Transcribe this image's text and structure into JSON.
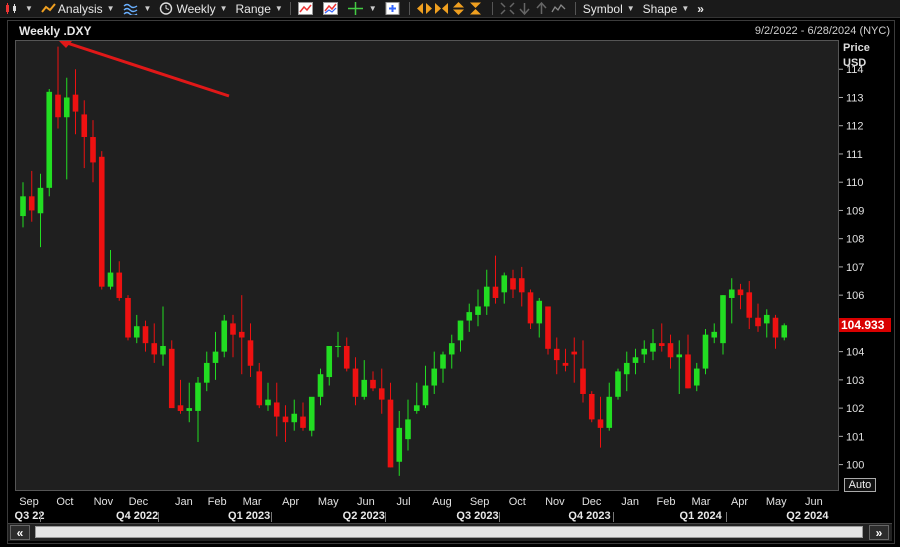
{
  "toolbar": {
    "analysis_label": "Analysis",
    "period_label": "Weekly",
    "range_label": "Range",
    "symbol_label": "Symbol",
    "shape_label": "Shape",
    "more_label": "»"
  },
  "header": {
    "title": "Weekly .DXY",
    "date_range": "9/2/2022 - 6/28/2024 (NYC)"
  },
  "axis": {
    "price_label": "Price",
    "unit_label": "USD",
    "auto_label": "Auto",
    "last_price_label": "104.933"
  },
  "colors": {
    "up": "#22dd22",
    "down": "#ee1111",
    "annotation": "#e01818",
    "price_tag": "#d90000"
  },
  "chart_data": {
    "type": "candlestick",
    "title": "Weekly .DXY",
    "ylabel": "Price USD",
    "ylim": [
      99.1,
      115
    ],
    "yticks": [
      100,
      101,
      102,
      103,
      104,
      105,
      106,
      107,
      108,
      109,
      110,
      111,
      112,
      113,
      114
    ],
    "last_price": 104.933,
    "month_labels": [
      "Sep",
      "Oct",
      "Nov",
      "Dec",
      "Jan",
      "Feb",
      "Mar",
      "Apr",
      "May",
      "Jun",
      "Jul",
      "Aug",
      "Sep",
      "Oct",
      "Nov",
      "Dec",
      "Jan",
      "Feb",
      "Mar",
      "Apr",
      "May",
      "Jun"
    ],
    "quarter_labels": [
      "Q3 22",
      "Q4 2022",
      "Q1 2023",
      "Q2 2023",
      "Q3 2023",
      "Q4 2023",
      "Q1 2024",
      "Q2 2024"
    ],
    "candles": [
      {
        "o": 108.8,
        "h": 110.0,
        "l": 108.4,
        "c": 109.5
      },
      {
        "o": 109.5,
        "h": 110.4,
        "l": 108.6,
        "c": 109.0
      },
      {
        "o": 108.9,
        "h": 110.3,
        "l": 107.7,
        "c": 109.8
      },
      {
        "o": 109.8,
        "h": 113.3,
        "l": 109.5,
        "c": 113.2
      },
      {
        "o": 113.1,
        "h": 114.8,
        "l": 111.9,
        "c": 112.3
      },
      {
        "o": 112.3,
        "h": 113.7,
        "l": 110.1,
        "c": 113.0
      },
      {
        "o": 113.1,
        "h": 114.0,
        "l": 111.7,
        "c": 112.5
      },
      {
        "o": 112.4,
        "h": 112.9,
        "l": 110.5,
        "c": 111.6
      },
      {
        "o": 111.6,
        "h": 112.2,
        "l": 110.0,
        "c": 110.7
      },
      {
        "o": 110.9,
        "h": 111.1,
        "l": 106.2,
        "c": 106.3
      },
      {
        "o": 106.3,
        "h": 107.6,
        "l": 106.2,
        "c": 106.8
      },
      {
        "o": 106.8,
        "h": 107.2,
        "l": 105.8,
        "c": 105.9
      },
      {
        "o": 105.9,
        "h": 106.0,
        "l": 104.4,
        "c": 104.5
      },
      {
        "o": 104.5,
        "h": 105.3,
        "l": 104.3,
        "c": 104.9
      },
      {
        "o": 104.9,
        "h": 105.1,
        "l": 104.0,
        "c": 104.3
      },
      {
        "o": 104.3,
        "h": 105.0,
        "l": 103.6,
        "c": 103.9
      },
      {
        "o": 103.9,
        "h": 105.6,
        "l": 103.5,
        "c": 104.2
      },
      {
        "o": 104.1,
        "h": 104.4,
        "l": 102.8,
        "c": 102.0
      },
      {
        "o": 102.1,
        "h": 103.0,
        "l": 101.8,
        "c": 101.9
      },
      {
        "o": 101.9,
        "h": 102.9,
        "l": 101.5,
        "c": 102.0
      },
      {
        "o": 101.9,
        "h": 103.1,
        "l": 100.8,
        "c": 102.9
      },
      {
        "o": 102.9,
        "h": 104.0,
        "l": 102.6,
        "c": 103.6
      },
      {
        "o": 103.6,
        "h": 104.7,
        "l": 103.0,
        "c": 104.0
      },
      {
        "o": 104.0,
        "h": 105.3,
        "l": 103.8,
        "c": 105.1
      },
      {
        "o": 105.0,
        "h": 105.3,
        "l": 103.8,
        "c": 104.6
      },
      {
        "o": 104.7,
        "h": 106.0,
        "l": 103.2,
        "c": 104.5
      },
      {
        "o": 104.4,
        "h": 105.0,
        "l": 103.1,
        "c": 103.5
      },
      {
        "o": 103.3,
        "h": 103.6,
        "l": 102.0,
        "c": 102.1
      },
      {
        "o": 102.1,
        "h": 102.9,
        "l": 101.9,
        "c": 102.3
      },
      {
        "o": 102.2,
        "h": 102.9,
        "l": 101.0,
        "c": 101.7
      },
      {
        "o": 101.7,
        "h": 102.1,
        "l": 100.8,
        "c": 101.5
      },
      {
        "o": 101.5,
        "h": 102.3,
        "l": 101.2,
        "c": 101.8
      },
      {
        "o": 101.7,
        "h": 102.2,
        "l": 101.2,
        "c": 101.3
      },
      {
        "o": 101.2,
        "h": 102.0,
        "l": 101.0,
        "c": 102.4
      },
      {
        "o": 102.4,
        "h": 103.4,
        "l": 102.1,
        "c": 103.2
      },
      {
        "o": 103.1,
        "h": 104.1,
        "l": 102.8,
        "c": 104.2
      },
      {
        "o": 104.2,
        "h": 104.7,
        "l": 103.8,
        "c": 104.2
      },
      {
        "o": 104.2,
        "h": 104.5,
        "l": 103.3,
        "c": 103.4
      },
      {
        "o": 103.4,
        "h": 103.8,
        "l": 102.1,
        "c": 102.4
      },
      {
        "o": 102.4,
        "h": 103.7,
        "l": 102.3,
        "c": 103.0
      },
      {
        "o": 103.0,
        "h": 103.3,
        "l": 102.6,
        "c": 102.7
      },
      {
        "o": 102.7,
        "h": 103.4,
        "l": 101.8,
        "c": 102.3
      },
      {
        "o": 102.3,
        "h": 102.9,
        "l": 99.9,
        "c": 99.9
      },
      {
        "o": 100.1,
        "h": 101.9,
        "l": 99.6,
        "c": 101.3
      },
      {
        "o": 100.9,
        "h": 102.3,
        "l": 100.5,
        "c": 101.6
      },
      {
        "o": 101.9,
        "h": 102.9,
        "l": 101.8,
        "c": 102.1
      },
      {
        "o": 102.1,
        "h": 103.5,
        "l": 102.0,
        "c": 102.8
      },
      {
        "o": 102.8,
        "h": 104.0,
        "l": 102.5,
        "c": 103.4
      },
      {
        "o": 103.4,
        "h": 104.0,
        "l": 102.9,
        "c": 103.9
      },
      {
        "o": 103.9,
        "h": 104.6,
        "l": 103.4,
        "c": 104.3
      },
      {
        "o": 104.4,
        "h": 105.1,
        "l": 104.0,
        "c": 105.1
      },
      {
        "o": 105.1,
        "h": 105.7,
        "l": 104.7,
        "c": 105.4
      },
      {
        "o": 105.3,
        "h": 106.2,
        "l": 104.9,
        "c": 105.6
      },
      {
        "o": 105.6,
        "h": 106.9,
        "l": 105.3,
        "c": 106.3
      },
      {
        "o": 106.3,
        "h": 107.4,
        "l": 105.7,
        "c": 105.9
      },
      {
        "o": 106.1,
        "h": 106.8,
        "l": 105.7,
        "c": 106.7
      },
      {
        "o": 106.6,
        "h": 106.9,
        "l": 105.9,
        "c": 106.2
      },
      {
        "o": 106.6,
        "h": 107.0,
        "l": 105.6,
        "c": 106.1
      },
      {
        "o": 106.1,
        "h": 106.2,
        "l": 104.8,
        "c": 105.0
      },
      {
        "o": 105.0,
        "h": 105.9,
        "l": 104.5,
        "c": 105.8
      },
      {
        "o": 105.6,
        "h": 105.6,
        "l": 103.9,
        "c": 104.1
      },
      {
        "o": 104.1,
        "h": 104.5,
        "l": 103.2,
        "c": 103.7
      },
      {
        "o": 103.6,
        "h": 104.1,
        "l": 103.3,
        "c": 103.5
      },
      {
        "o": 104.0,
        "h": 104.5,
        "l": 102.9,
        "c": 103.9
      },
      {
        "o": 103.4,
        "h": 104.4,
        "l": 102.2,
        "c": 102.5
      },
      {
        "o": 102.5,
        "h": 102.6,
        "l": 101.5,
        "c": 101.6
      },
      {
        "o": 101.6,
        "h": 102.4,
        "l": 100.6,
        "c": 101.3
      },
      {
        "o": 101.3,
        "h": 102.9,
        "l": 101.2,
        "c": 102.4
      },
      {
        "o": 102.4,
        "h": 103.4,
        "l": 102.3,
        "c": 103.3
      },
      {
        "o": 103.2,
        "h": 104.0,
        "l": 102.6,
        "c": 103.6
      },
      {
        "o": 103.6,
        "h": 104.1,
        "l": 103.2,
        "c": 103.8
      },
      {
        "o": 103.9,
        "h": 104.4,
        "l": 103.6,
        "c": 104.1
      },
      {
        "o": 104.0,
        "h": 104.8,
        "l": 103.7,
        "c": 104.3
      },
      {
        "o": 104.3,
        "h": 105.0,
        "l": 104.0,
        "c": 104.2
      },
      {
        "o": 104.3,
        "h": 104.6,
        "l": 103.4,
        "c": 103.8
      },
      {
        "o": 103.8,
        "h": 104.4,
        "l": 102.5,
        "c": 103.9
      },
      {
        "o": 103.9,
        "h": 104.6,
        "l": 102.7,
        "c": 102.7
      },
      {
        "o": 102.8,
        "h": 103.6,
        "l": 102.6,
        "c": 103.4
      },
      {
        "o": 103.4,
        "h": 104.8,
        "l": 103.2,
        "c": 104.6
      },
      {
        "o": 104.5,
        "h": 105.0,
        "l": 104.3,
        "c": 104.7
      },
      {
        "o": 104.3,
        "h": 106.0,
        "l": 103.9,
        "c": 106.0
      },
      {
        "o": 105.9,
        "h": 106.6,
        "l": 105.0,
        "c": 106.2
      },
      {
        "o": 106.2,
        "h": 106.4,
        "l": 105.5,
        "c": 106.0
      },
      {
        "o": 106.1,
        "h": 106.5,
        "l": 104.8,
        "c": 105.2
      },
      {
        "o": 105.2,
        "h": 105.7,
        "l": 104.7,
        "c": 104.9
      },
      {
        "o": 105.0,
        "h": 105.5,
        "l": 104.5,
        "c": 105.3
      },
      {
        "o": 105.2,
        "h": 105.3,
        "l": 104.1,
        "c": 104.5
      },
      {
        "o": 104.5,
        "h": 105.0,
        "l": 104.4,
        "c": 104.933
      }
    ]
  }
}
